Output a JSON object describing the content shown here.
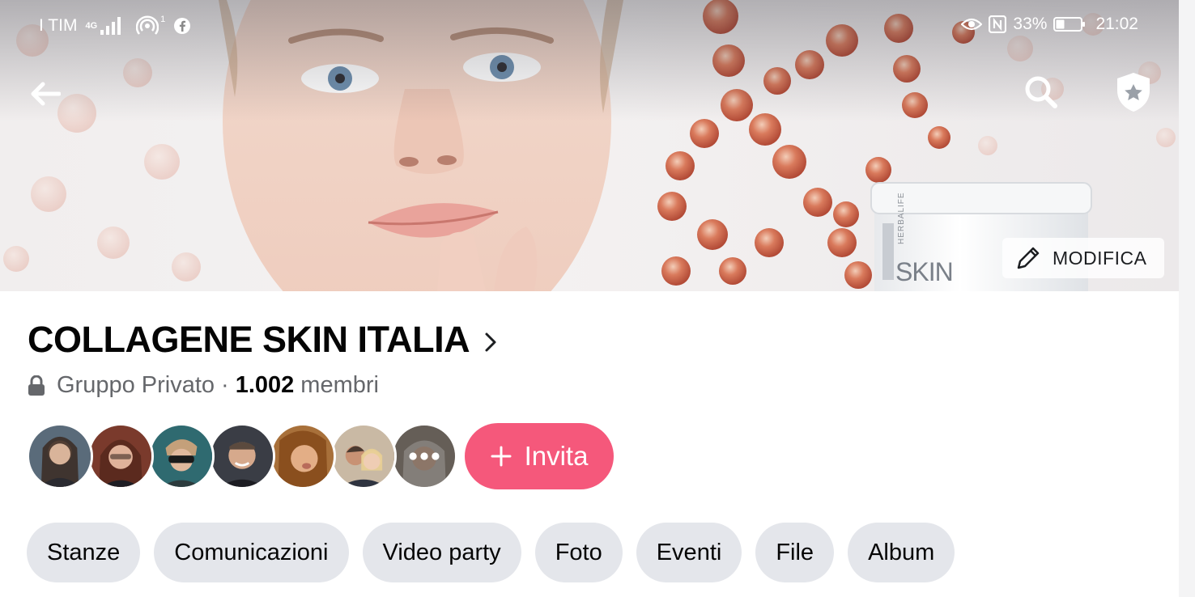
{
  "status_bar": {
    "carrier": "I TIM",
    "network": "4G",
    "hotspot_badge": "1",
    "battery": "33%",
    "time": "21:02"
  },
  "cover": {
    "product_brand": "HERBALIFE",
    "product_name": "SKIN",
    "edit_label": "MODIFICA"
  },
  "group": {
    "name": "COLLAGENE SKIN ITALIA",
    "privacy": "Gruppo Privato",
    "separator": "·",
    "member_count": "1.002",
    "members_label": "membri"
  },
  "invite": {
    "plus": "+",
    "label": "Invita"
  },
  "tabs": [
    "Stanze",
    "Comunicazioni",
    "Video party",
    "Foto",
    "Eventi",
    "File",
    "Album"
  ],
  "colors": {
    "invite": "#f5587b",
    "chip_bg": "#e4e6eb",
    "text_secondary": "#65676b"
  },
  "icons": [
    "back-arrow-icon",
    "search-icon",
    "admin-shield-icon",
    "pencil-icon",
    "chevron-right-icon",
    "lock-icon",
    "more-icon"
  ]
}
